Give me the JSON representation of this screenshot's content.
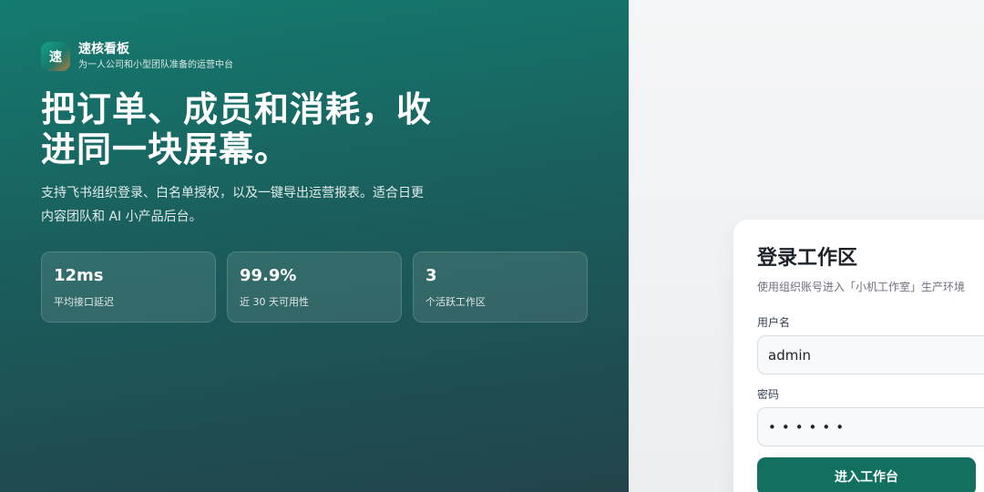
{
  "brand": {
    "logo_char": "速",
    "name": "速核看板",
    "tagline": "为一人公司和小型团队准备的运营中台"
  },
  "hero": {
    "headline": "把订单、成员和消耗，收进同一块屏幕。",
    "subtitle": "支持飞书组织登录、白名单授权，以及一键导出运营报表。适合日更内容团队和 AI 小产品后台。"
  },
  "stats": [
    {
      "value": "12ms",
      "label": "平均接口延迟"
    },
    {
      "value": "99.9%",
      "label": "近 30 天可用性"
    },
    {
      "value": "3",
      "label": "个活跃工作区"
    }
  ],
  "login": {
    "title": "登录工作区",
    "description": "使用组织账号进入「小机工作室」生产环境",
    "username_label": "用户名",
    "username_value": "admin",
    "password_label": "密码",
    "password_value": "••••••",
    "submit_label": "进入工作台"
  },
  "colors": {
    "hero_gradient_start": "#147b70",
    "hero_gradient_end": "#22444a",
    "primary_button": "#11705f"
  }
}
